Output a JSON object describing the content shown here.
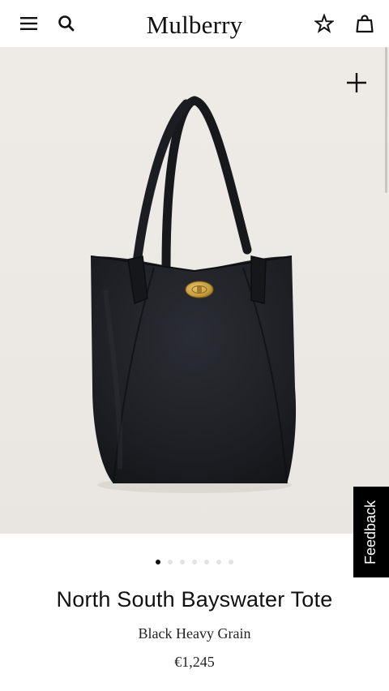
{
  "header": {
    "brand": "Mulberry",
    "icons": [
      "menu-icon",
      "search-icon",
      "star-icon",
      "bag-icon"
    ]
  },
  "gallery": {
    "total_images": 7,
    "active_index": 0,
    "zoom_icon": "plus-icon"
  },
  "feedback": {
    "label": "Feedback"
  },
  "product": {
    "name": "North South Bayswater Tote",
    "color": "Black Heavy Grain",
    "price": "€1,245"
  },
  "colors": {
    "accent": "#111111",
    "background": "#ffffff",
    "hero_background": "#ece9e4",
    "bag": "#1c1e22",
    "hardware": "#c49a3c"
  }
}
